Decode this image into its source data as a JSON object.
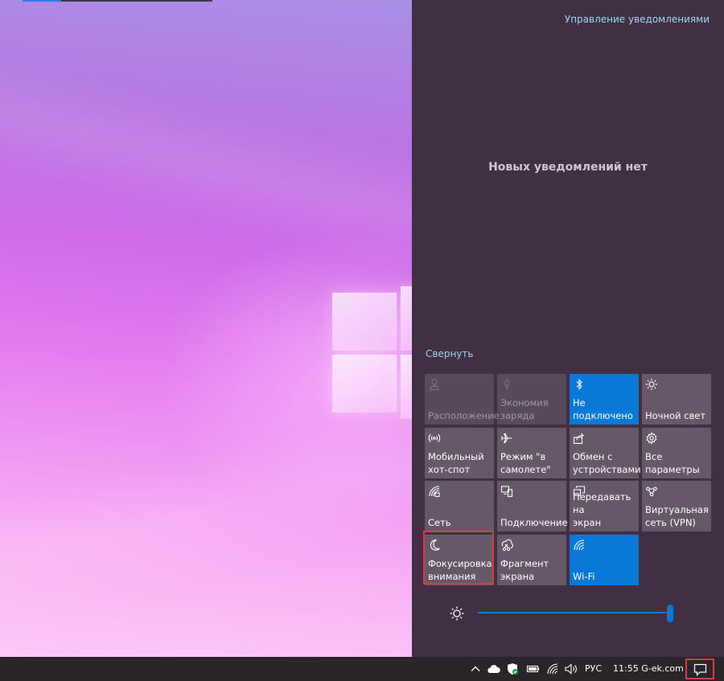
{
  "action_center": {
    "manage_label": "Управление уведомлениями",
    "empty_message": "Новых уведомлений нет",
    "collapse_label": "Свернуть",
    "tiles": [
      {
        "label": "Расположение",
        "icon": "location-icon",
        "state": "disabled"
      },
      {
        "label": "Экономия\nзаряда",
        "icon": "battery-saver-icon",
        "state": "disabled"
      },
      {
        "label": "Не\nподключено",
        "icon": "bluetooth-icon",
        "state": "on"
      },
      {
        "label": "Ночной свет",
        "icon": "night-light-icon",
        "state": "off"
      },
      {
        "label": "Мобильный\nхот-спот",
        "icon": "mobile-hotspot-icon",
        "state": "off"
      },
      {
        "label": "Режим \"в\nсамолете\"",
        "icon": "airplane-icon",
        "state": "off"
      },
      {
        "label": "Обмен с\nустройствами",
        "icon": "nearby-sharing-icon",
        "state": "off"
      },
      {
        "label": "Все параметры",
        "icon": "settings-gear-icon",
        "state": "off"
      },
      {
        "label": "Сеть",
        "icon": "network-icon",
        "state": "off"
      },
      {
        "label": "Подключение",
        "icon": "connect-icon",
        "state": "off"
      },
      {
        "label": "Передавать на\nэкран",
        "icon": "project-icon",
        "state": "off"
      },
      {
        "label": "Виртуальная\nсеть (VPN)",
        "icon": "vpn-icon",
        "state": "off"
      },
      {
        "label": "Фокусировка\nвнимания",
        "icon": "focus-assist-moon-icon",
        "state": "off",
        "highlighted": true
      },
      {
        "label": "Фрагмент\nэкрана",
        "icon": "screen-snip-icon",
        "state": "off"
      },
      {
        "label": "Wi-Fi",
        "icon": "wifi-icon",
        "state": "on"
      }
    ],
    "brightness_level": 1.0
  },
  "taskbar": {
    "language": "РУС",
    "clock": "11:55 G-ek.com",
    "tray_icons": [
      "chevron-up-icon",
      "onedrive-cloud-icon",
      "windows-security-icon",
      "battery-icon",
      "wifi-icon",
      "volume-icon"
    ]
  },
  "colors": {
    "accent": "#0a78d6",
    "highlight": "#e0393a",
    "panel": "#412f44",
    "link": "#9fd6f4"
  }
}
